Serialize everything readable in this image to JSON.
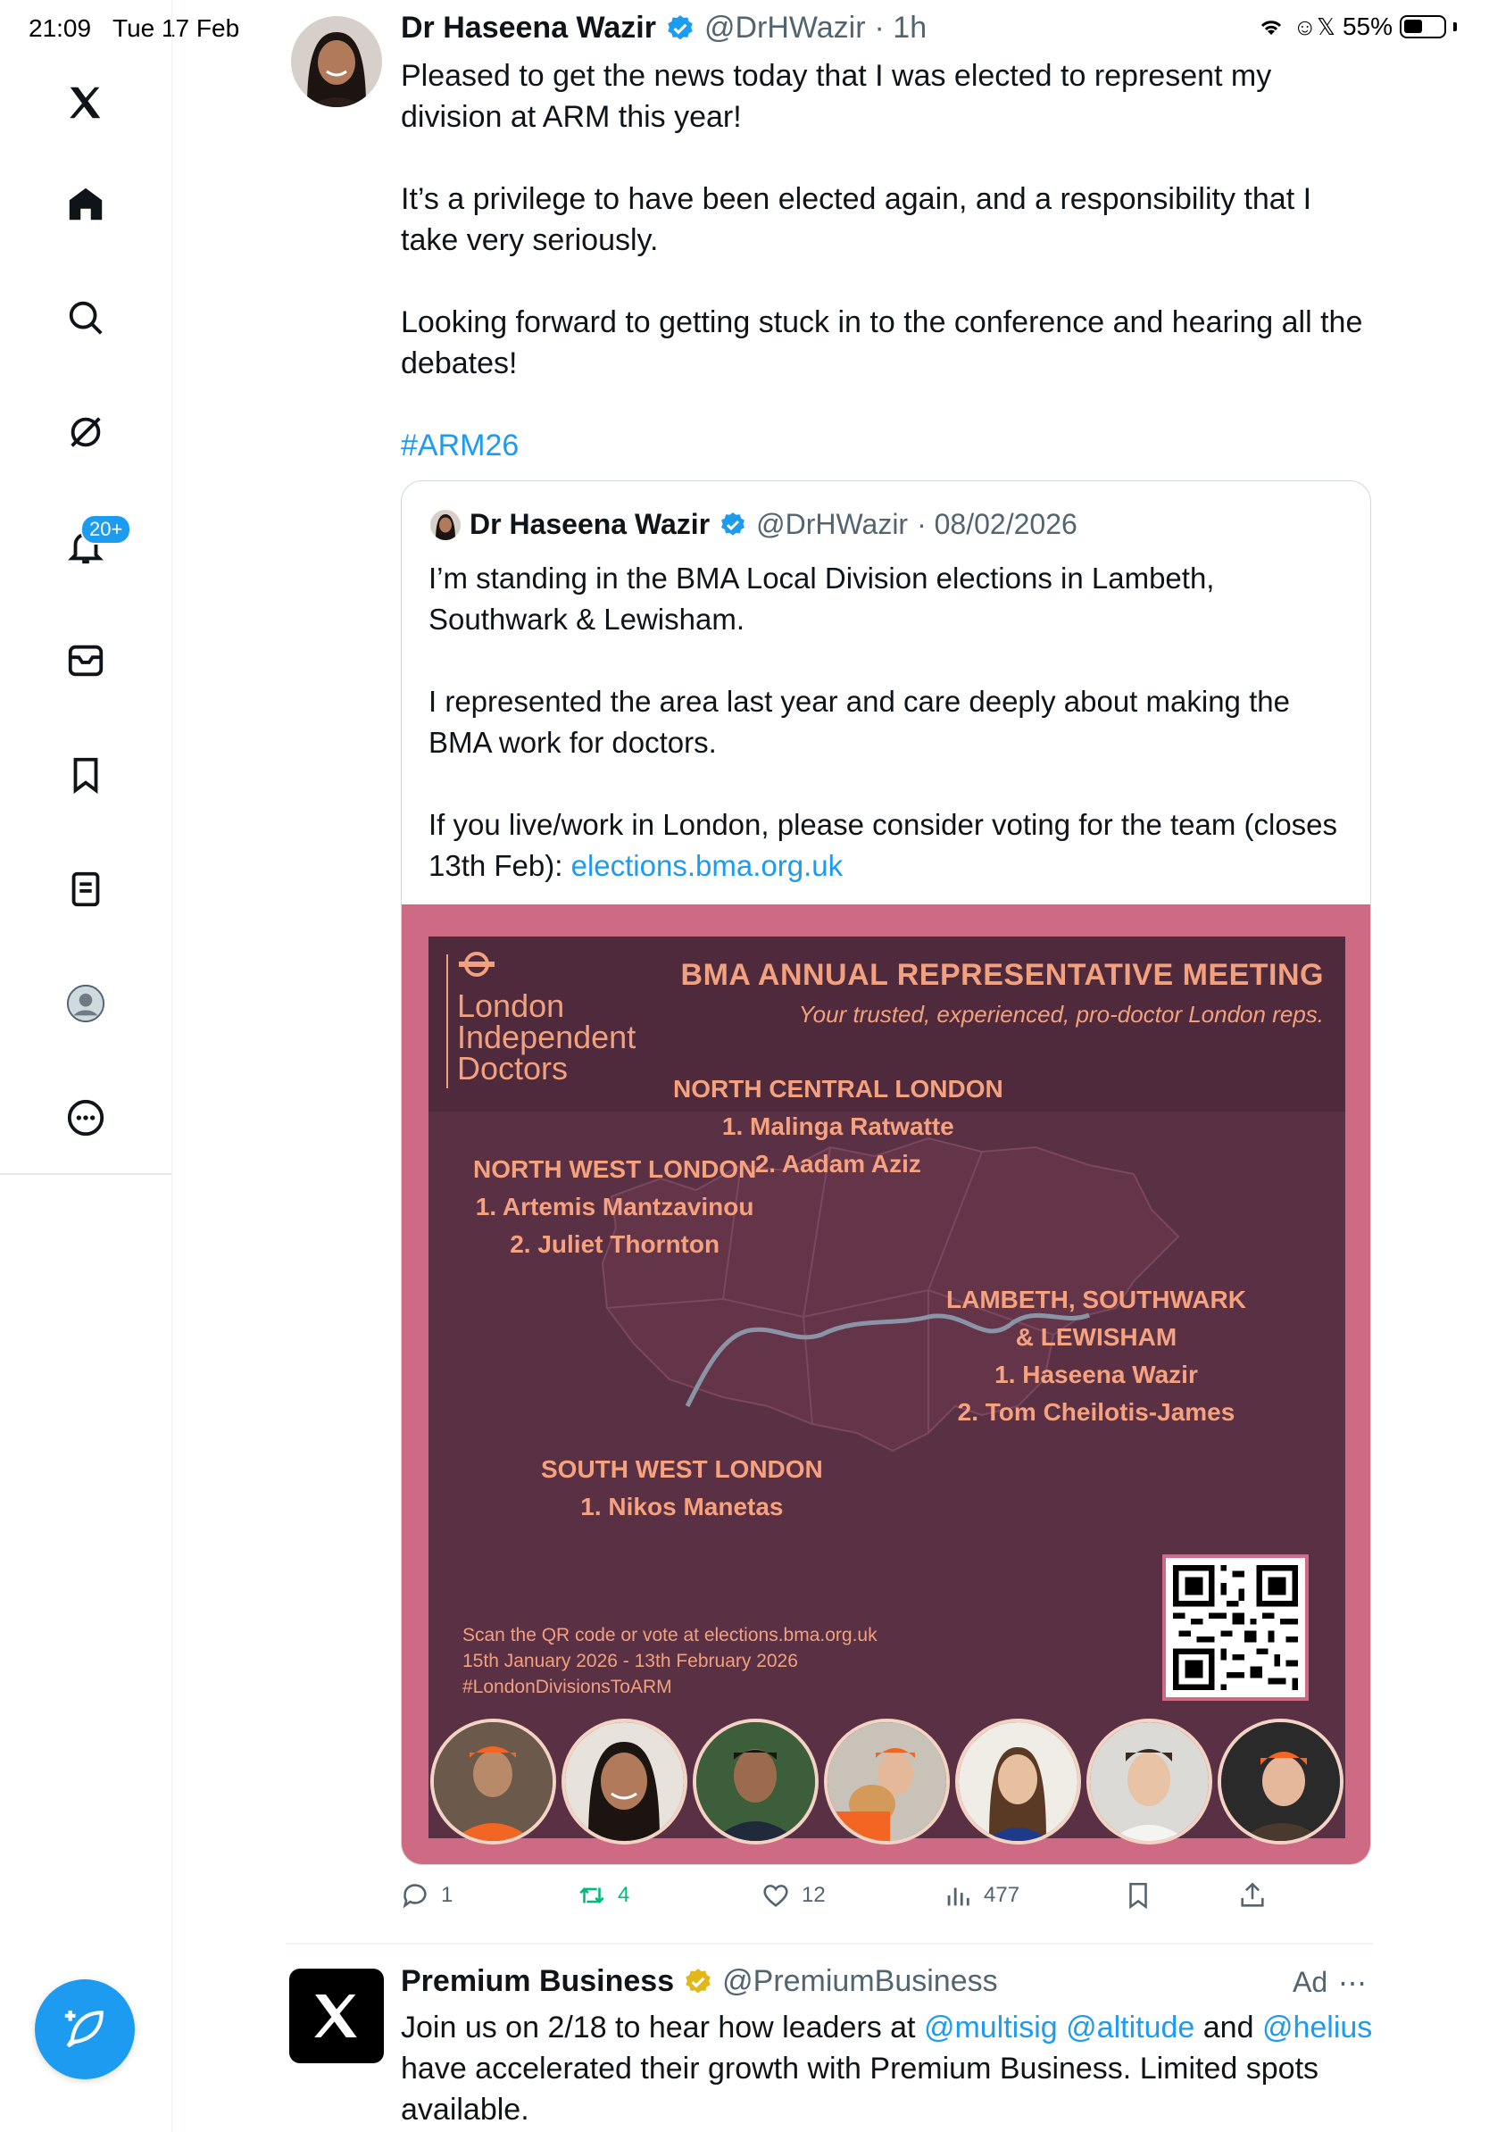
{
  "status_bar": {
    "time": "21:09",
    "date": "Tue 17 Feb",
    "battery": "55%"
  },
  "sidebar": {
    "notifications_badge": "20+"
  },
  "post": {
    "author_name": "Dr Haseena Wazir",
    "author_handle": "@DrHWazir",
    "time": "· 1h",
    "paragraphs": [
      "Pleased to get the news today that I was elected to represent my division at ARM this year!",
      "It’s a privilege to have been elected again, and a responsibility that I take very seriously.",
      "Looking forward to getting stuck in to the conference and hearing all the debates!"
    ],
    "hashtag": "#ARM26"
  },
  "quoted": {
    "author_name": "Dr Haseena Wazir",
    "author_handle": "@DrHWazir",
    "date": "· 08/02/2026",
    "paragraphs": [
      "I’m standing in the BMA Local Division elections in Lambeth, Southwark & Lewisham.",
      "I represented the area last year and care deeply about making the BMA work for doctors."
    ],
    "last_paragraph": "If you live/work in London, please consider voting for the team (closes 13th Feb): ",
    "link": "elections.bma.org.uk"
  },
  "poster": {
    "org": [
      "London",
      "Independent",
      "Doctors"
    ],
    "title": "BMA ANNUAL REPRESENTATIVE MEETING",
    "subtitle": "Your trusted, experienced, pro-doctor London reps.",
    "regions": {
      "north_central": {
        "name": "NORTH CENTRAL LONDON",
        "c1": "1. Malinga Ratwatte",
        "c2": "2. Aadam Aziz"
      },
      "north_west": {
        "name": "NORTH WEST LONDON",
        "c1": "1. Artemis Mantzavinou",
        "c2": "2. Juliet Thornton"
      },
      "lambeth": {
        "name1": "LAMBETH, SOUTHWARK",
        "name2": "& LEWISHAM",
        "c1": "1. Haseena Wazir",
        "c2": "2. Tom Cheilotis-James"
      },
      "south_west": {
        "name": "SOUTH WEST LONDON",
        "c1": "1. Nikos Manetas"
      }
    },
    "footer": {
      "line1": "Scan the QR code or vote at elections.bma.org.uk",
      "line2": "15th January 2026 - 13th February 2026",
      "line3": "#LondonDivisionsToARM"
    }
  },
  "actions": {
    "replies": "1",
    "reposts": "4",
    "likes": "12",
    "views": "477"
  },
  "ad": {
    "name": "Premium Business",
    "handle": "@PremiumBusiness",
    "label": "Ad",
    "text_before": "Join us on 2/18 to hear how leaders at ",
    "mention1": "@multisig",
    "mention2": "@altitude",
    "text_and": " and ",
    "mention3": "@helius",
    "text_after": " have accelerated their growth with Premium Business. Limited spots available."
  },
  "colors": {
    "accent": "#1d9bf0",
    "repost_green": "#00ba7c",
    "poster_pink": "#cf6a84",
    "poster_text": "#f2a17e"
  }
}
